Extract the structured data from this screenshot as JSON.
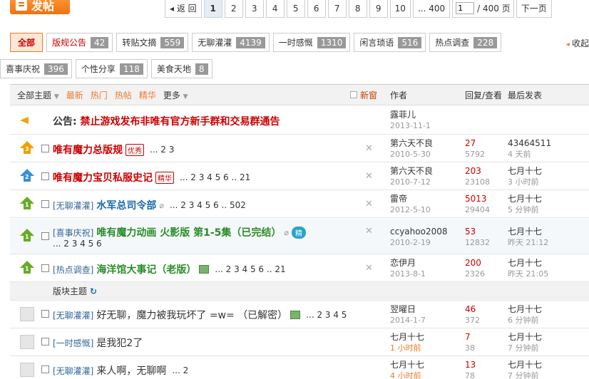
{
  "topbar": {
    "post_label": "发帖",
    "pager": {
      "prev": "◂ 返 回",
      "pages": [
        "1",
        "2",
        "3",
        "4",
        "5",
        "6",
        "7",
        "8",
        "9",
        "10",
        "... 400"
      ],
      "current": "1",
      "input_value": "1",
      "total": "/ 400 页",
      "next": "下一页"
    }
  },
  "categories": [
    {
      "label": "全部",
      "count": ""
    },
    {
      "label": "版规公告",
      "count": "42"
    },
    {
      "label": "转贴文摘",
      "count": "559"
    },
    {
      "label": "无聊灌灌",
      "count": "4139"
    },
    {
      "label": "一时感慨",
      "count": "1310"
    },
    {
      "label": "闲言琐语",
      "count": "516"
    },
    {
      "label": "热点调查",
      "count": "228"
    },
    {
      "label": "喜事庆祝",
      "count": "396"
    },
    {
      "label": "个性分享",
      "count": "118"
    },
    {
      "label": "美食天地",
      "count": "8"
    }
  ],
  "collapse_label": "收起",
  "thead": {
    "all_topics": "全部主题",
    "newest": "最新",
    "hot": "热门",
    "hot_posts": "热帖",
    "digest": "精华",
    "more": "更多",
    "new_window": "新窗",
    "author": "作者",
    "reply_view": "回复/查看",
    "last_post": "最后发表"
  },
  "notice": {
    "label": "公告:",
    "text": "禁止游戏发布非唯有官方新手群和交易群通告",
    "author": "露菲儿",
    "date": "2013-11-1"
  },
  "rows": [
    {
      "tag": "",
      "title": "唯有魔力总版规",
      "badge": "优秀",
      "pages": "... 2  3",
      "author": "第六天不良",
      "date": "2010-5-30",
      "replies": "27",
      "views": "5792",
      "last_author": "43464511",
      "last_time": "4 天前"
    },
    {
      "tag": "",
      "title": "唯有魔力宝贝私服史记",
      "badge": "精华",
      "pages": "... 2  3  4  5  6 .. 21",
      "author": "第六天不良",
      "date": "2010-7-12",
      "replies": "203",
      "views": "23108",
      "last_author": "七月十七",
      "last_time": "3 小时前"
    },
    {
      "tag": "[无聊灌灌]",
      "title": "水军总司令部",
      "badge": "",
      "pages": "... 2  3  4  5  6 .. 502",
      "author": "雷帝",
      "date": "2012-5-10",
      "replies": "5013",
      "views": "29404",
      "last_author": "七月十七",
      "last_time": "5 分钟前"
    },
    {
      "tag": "[喜事庆祝]",
      "title": "唯有魔力动画 火影版 第1-5集（已完结）",
      "badge": "精",
      "pages": "... 2  3  4  5  6",
      "author": "ccyahoo2008",
      "date": "2010-2-19",
      "replies": "53",
      "views": "12832",
      "last_author": "七月十七",
      "last_time": "昨天 21:12"
    },
    {
      "tag": "[热点调查]",
      "title": "海洋馆大事记（老版）",
      "badge": "",
      "pages": "... 2  3  4  5  6 .. 21",
      "author": "恋伊月",
      "date": "2013-8-1",
      "replies": "200",
      "views": "2326",
      "last_author": "七月十七",
      "last_time": "昨天 21:05"
    }
  ],
  "section_label": "版块主题",
  "normal_rows": [
    {
      "tag": "[无聊灌灌]",
      "title": "好无聊，魔力被我玩坏了 =w= （已解密）",
      "pages": "... 2  3  4  5",
      "author": "翌曜日",
      "date": "2014-1-7",
      "replies": "46",
      "views": "372",
      "last_author": "七月十七",
      "last_time": "6 分钟前"
    },
    {
      "tag": "[一时感慨]",
      "title": "是我犯2了",
      "pages": "",
      "author": "七月十七",
      "date": "1 小时前",
      "replies": "7",
      "views": "38",
      "last_author": "七月十七",
      "last_time": "7 分钟前"
    },
    {
      "tag": "[无聊灌灌]",
      "title": "来人啊，无聊啊",
      "pages": "... 2",
      "author": "七月十七",
      "date": "4 小时前",
      "replies": "13",
      "views": "78",
      "last_author": "七月十七",
      "last_time": "7 分钟前"
    }
  ]
}
